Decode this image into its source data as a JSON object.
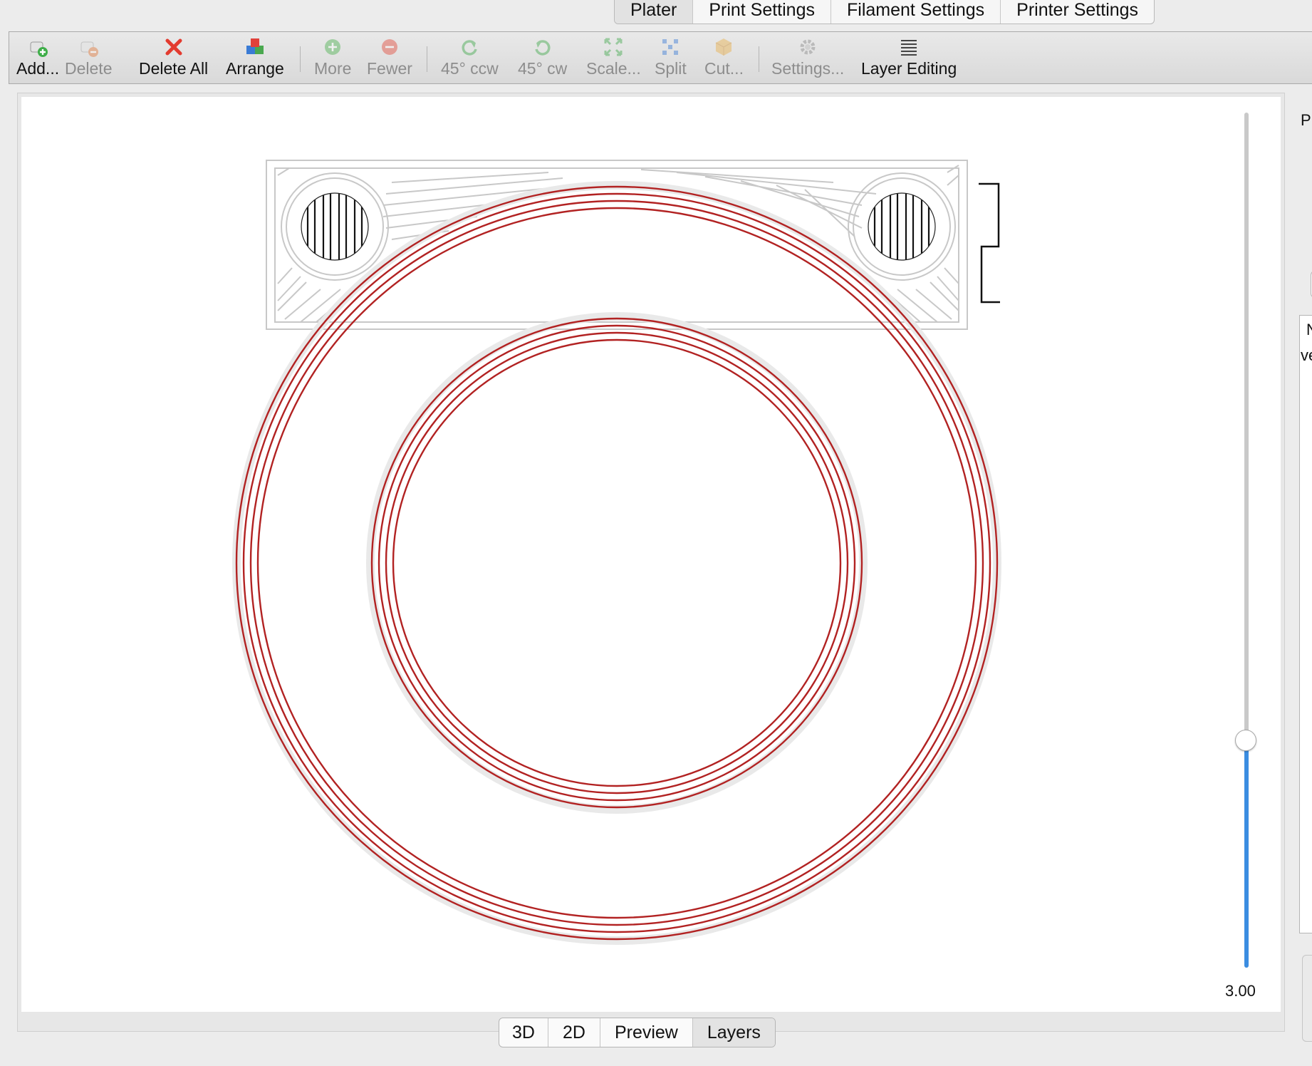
{
  "top_tabs": [
    {
      "label": "Plater",
      "selected": true
    },
    {
      "label": "Print Settings",
      "selected": false
    },
    {
      "label": "Filament Settings",
      "selected": false
    },
    {
      "label": "Printer Settings",
      "selected": false
    }
  ],
  "toolbar": {
    "add": "Add...",
    "delete": "Delete",
    "delete_all": "Delete All",
    "arrange": "Arrange",
    "more": "More",
    "fewer": "Fewer",
    "rotate_ccw": "45° ccw",
    "rotate_cw": "45° cw",
    "scale": "Scale...",
    "split": "Split",
    "cut": "Cut...",
    "settings": "Settings...",
    "layer_editing": "Layer Editing"
  },
  "layer_slider": {
    "value_label": "3.00",
    "fraction": 0.27
  },
  "view_tabs": [
    {
      "label": "3D",
      "selected": false
    },
    {
      "label": "2D",
      "selected": false
    },
    {
      "label": "Preview",
      "selected": false
    },
    {
      "label": "Layers",
      "selected": true
    }
  ],
  "sidebar": {
    "label_fragment": "P",
    "list_header_1": "N",
    "list_header_2": "ve"
  },
  "colors": {
    "perimeter": "#b22222",
    "accent_slider": "#3b8de1",
    "infill": "#c8c8c8"
  }
}
